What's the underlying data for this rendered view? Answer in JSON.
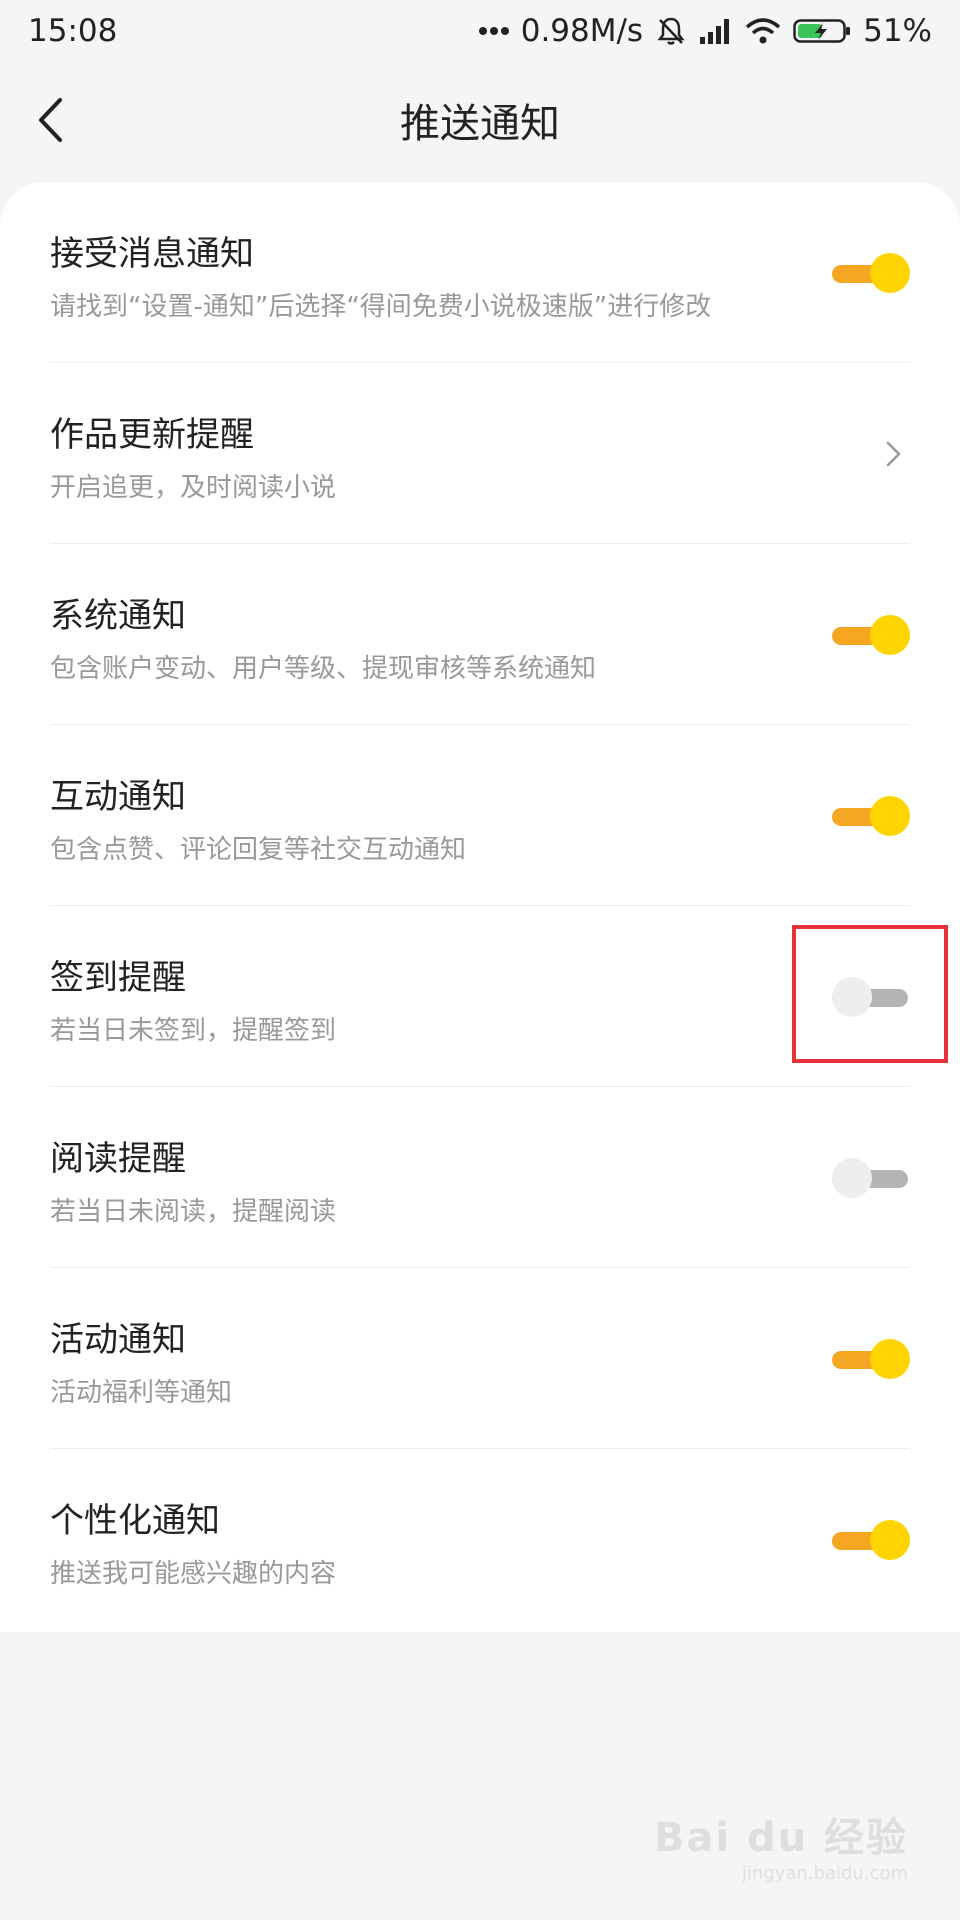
{
  "status_bar": {
    "time": "15:08",
    "network_speed": "0.98M/s",
    "battery": "51%",
    "icons": [
      "more-dots-icon",
      "mute-bell-icon",
      "signal-icon",
      "wifi-icon",
      "battery-charging-icon"
    ]
  },
  "header": {
    "title": "推送通知",
    "back_icon": "chevron-left-icon"
  },
  "items": [
    {
      "title": "接受消息通知",
      "subtitle": "请找到“设置-通知”后选择“得间免费小说极速版”进行修改",
      "control": "toggle",
      "state": "on"
    },
    {
      "title": "作品更新提醒",
      "subtitle": "开启追更，及时阅读小说",
      "control": "chevron",
      "state": ""
    },
    {
      "title": "系统通知",
      "subtitle": "包含账户变动、用户等级、提现审核等系统通知",
      "control": "toggle",
      "state": "on"
    },
    {
      "title": "互动通知",
      "subtitle": "包含点赞、评论回复等社交互动通知",
      "control": "toggle",
      "state": "on"
    },
    {
      "title": "签到提醒",
      "subtitle": "若当日未签到，提醒签到",
      "control": "toggle",
      "state": "off"
    },
    {
      "title": "阅读提醒",
      "subtitle": "若当日未阅读，提醒阅读",
      "control": "toggle",
      "state": "off"
    },
    {
      "title": "活动通知",
      "subtitle": "活动福利等通知",
      "control": "toggle",
      "state": "on"
    },
    {
      "title": "个性化通知",
      "subtitle": "推送我可能感兴趣的内容",
      "control": "toggle",
      "state": "on"
    }
  ],
  "colors": {
    "toggle_on_track": "#f5a623",
    "toggle_on_knob": "#ffd400",
    "toggle_off_track": "#b4b4b4",
    "toggle_off_knob": "#eeeeee",
    "highlight": "#e8323a"
  },
  "watermark": {
    "main": "Bai du 经验",
    "sub": "jingyan.baidu.com"
  }
}
